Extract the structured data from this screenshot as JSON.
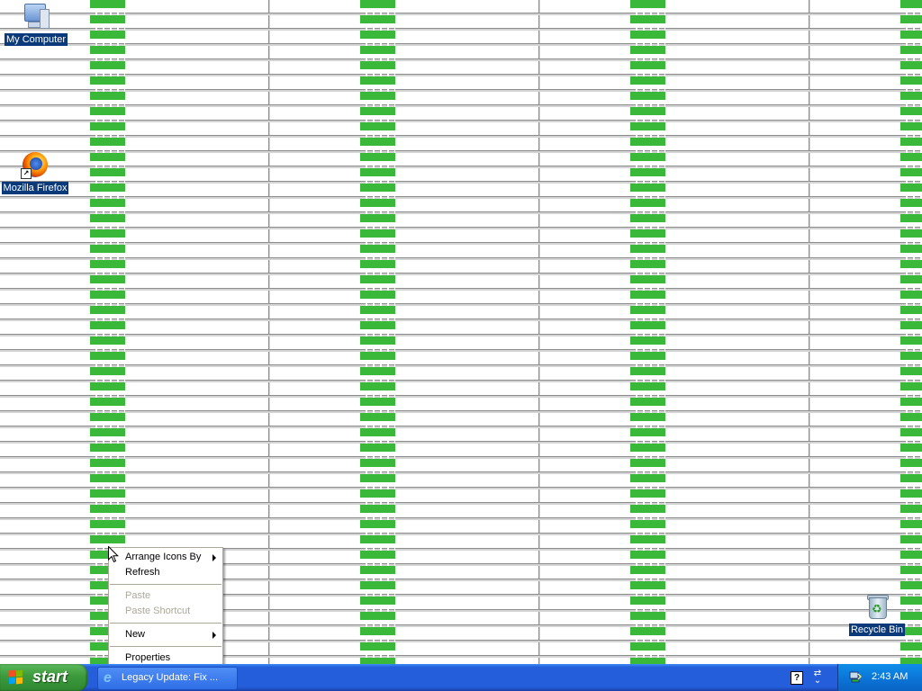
{
  "desktop": {
    "icons": {
      "my_computer": "My Computer",
      "firefox": "Mozilla Firefox",
      "recycle_bin": "Recycle Bin"
    }
  },
  "context_menu": {
    "arrange_icons_by": "Arrange Icons By",
    "refresh": "Refresh",
    "paste": "Paste",
    "paste_shortcut": "Paste Shortcut",
    "new": "New",
    "properties": "Properties"
  },
  "taskbar": {
    "start_label": "start",
    "tasks": [
      {
        "label": "Legacy Update: Fix ...",
        "icon": "internet-explorer-icon"
      }
    ],
    "tray": {
      "help_glyph": "?",
      "clock": "2:43 AM"
    }
  },
  "colors": {
    "taskbar_blue": "#245edb",
    "start_green": "#3c9a3c",
    "wallpaper_green": "#2fb52f",
    "selection_blue": "#0b3a7a"
  }
}
